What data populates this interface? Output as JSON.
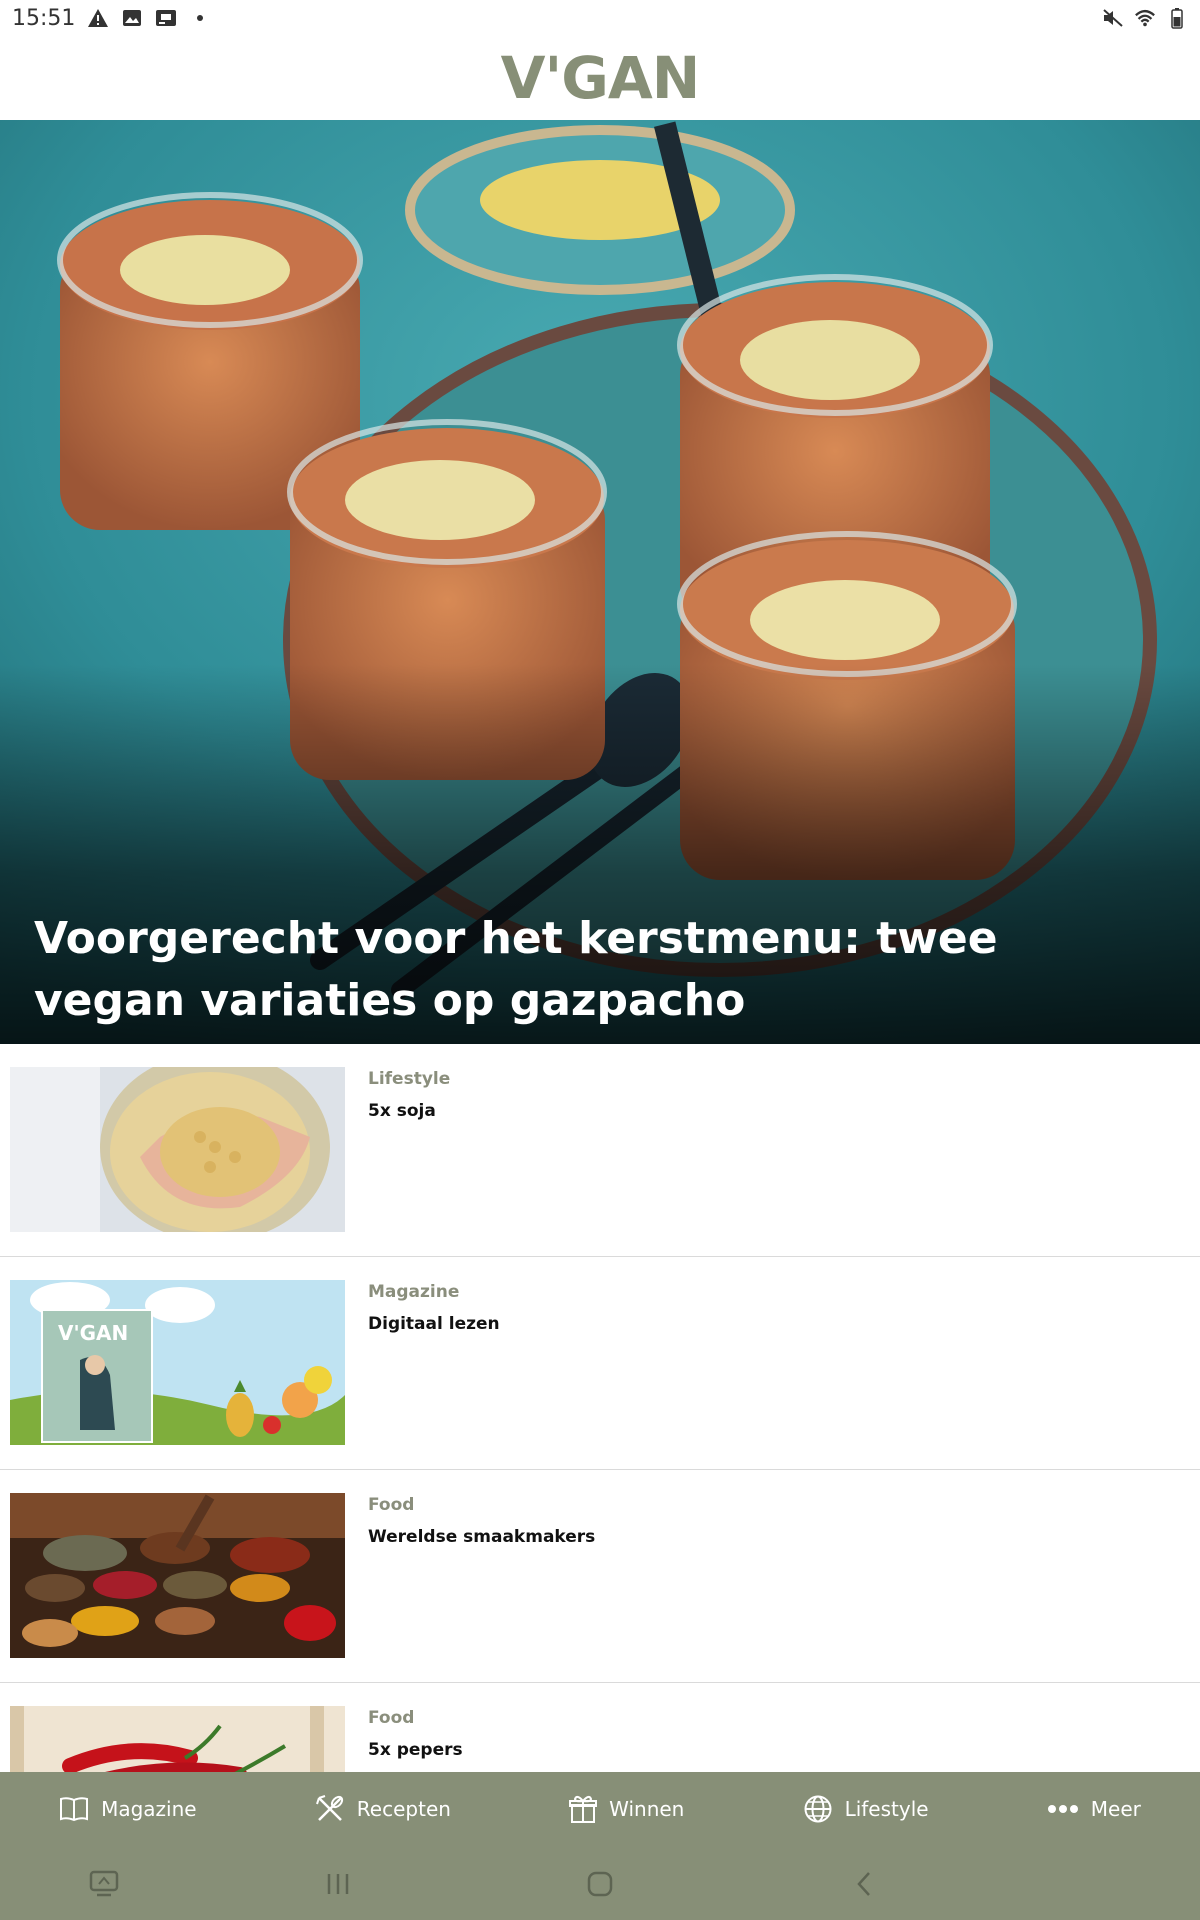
{
  "status_bar": {
    "time": "15:51",
    "left_icons": [
      "alert-icon",
      "image-icon",
      "cast-icon",
      "dot-icon"
    ],
    "right_icons": [
      "mute-icon",
      "wifi-icon",
      "battery-icon"
    ]
  },
  "header": {
    "logo_text": "V'GAN"
  },
  "hero": {
    "title": "Voorgerecht voor het kerstmenu: twee vegan variaties op gazpacho"
  },
  "articles": [
    {
      "category": "Lifestyle",
      "title": "5x soja"
    },
    {
      "category": "Magazine",
      "title": "Digitaal lezen"
    },
    {
      "category": "Food",
      "title": "Wereldse smaakmakers"
    },
    {
      "category": "Food",
      "title": "5x pepers"
    }
  ],
  "tabbar": {
    "items": [
      {
        "label": "Magazine",
        "icon": "book-icon"
      },
      {
        "label": "Recepten",
        "icon": "utensils-icon"
      },
      {
        "label": "Winnen",
        "icon": "gift-icon"
      },
      {
        "label": "Lifestyle",
        "icon": "globe-icon"
      },
      {
        "label": "Meer",
        "icon": "more-dots-icon"
      }
    ]
  },
  "colors": {
    "brand": "#878f77",
    "category_text": "#8a8e7c"
  }
}
